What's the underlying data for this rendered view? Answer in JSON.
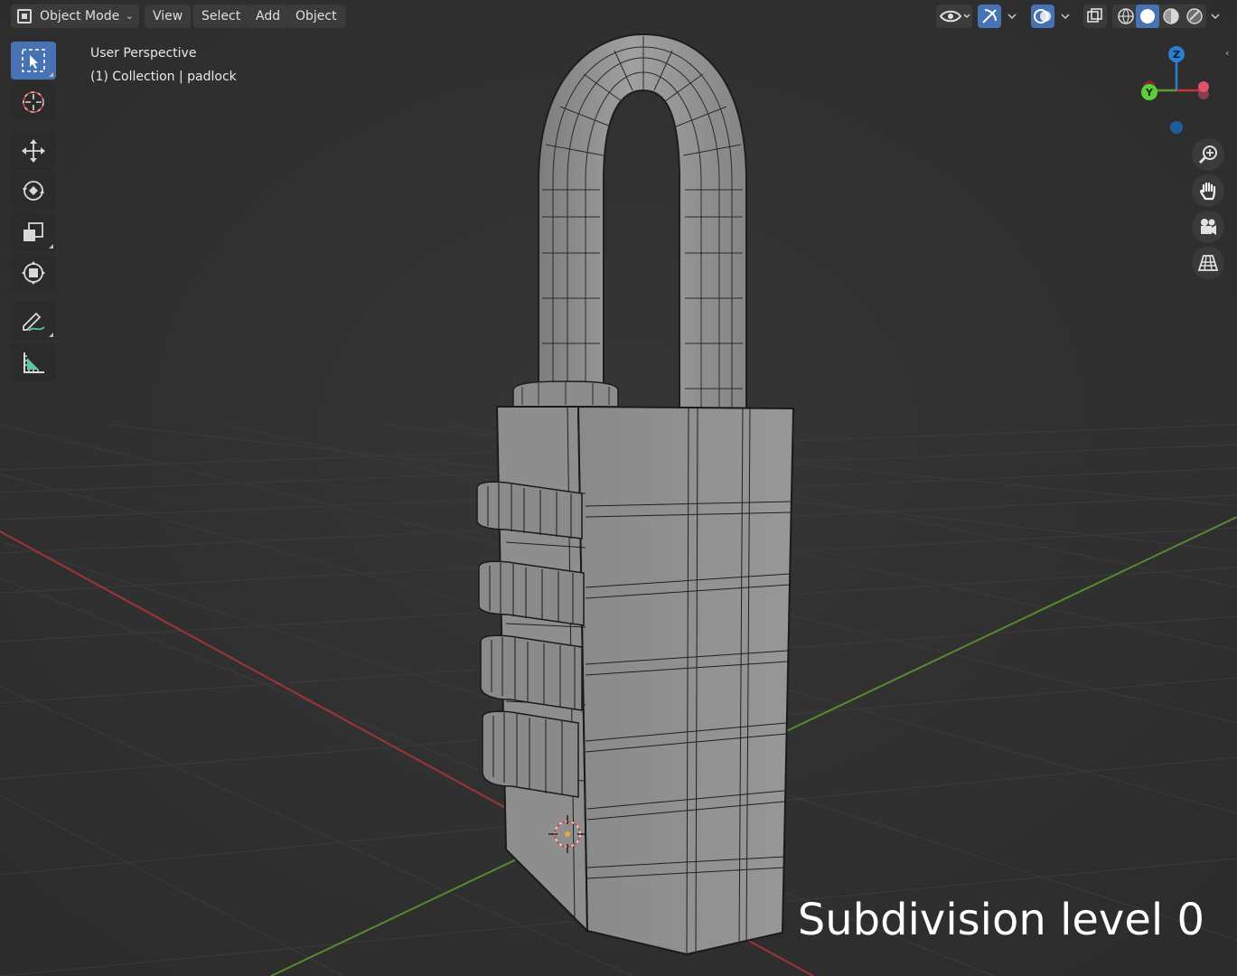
{
  "header": {
    "mode_label": "Object Mode",
    "menus": [
      "View",
      "Select",
      "Add",
      "Object"
    ]
  },
  "overlay": {
    "view_name": "User Perspective",
    "collection_label": "(1) Collection | padlock"
  },
  "gizmo": {
    "z": "Z",
    "y": "Y"
  },
  "caption": "Subdivision level 0",
  "toolbar": {
    "tools": [
      "select-box",
      "cursor",
      "move",
      "rotate",
      "scale",
      "transform",
      "annotate",
      "measure"
    ]
  },
  "navigation": [
    "zoom",
    "pan",
    "camera",
    "perspective-toggle"
  ],
  "colors": {
    "background": "#303030",
    "accent": "#4772b3",
    "axis_x": "#c0373d",
    "axis_y": "#5b9e2c",
    "axis_z": "#2a7fd4",
    "mesh": "#8d8d8d"
  }
}
